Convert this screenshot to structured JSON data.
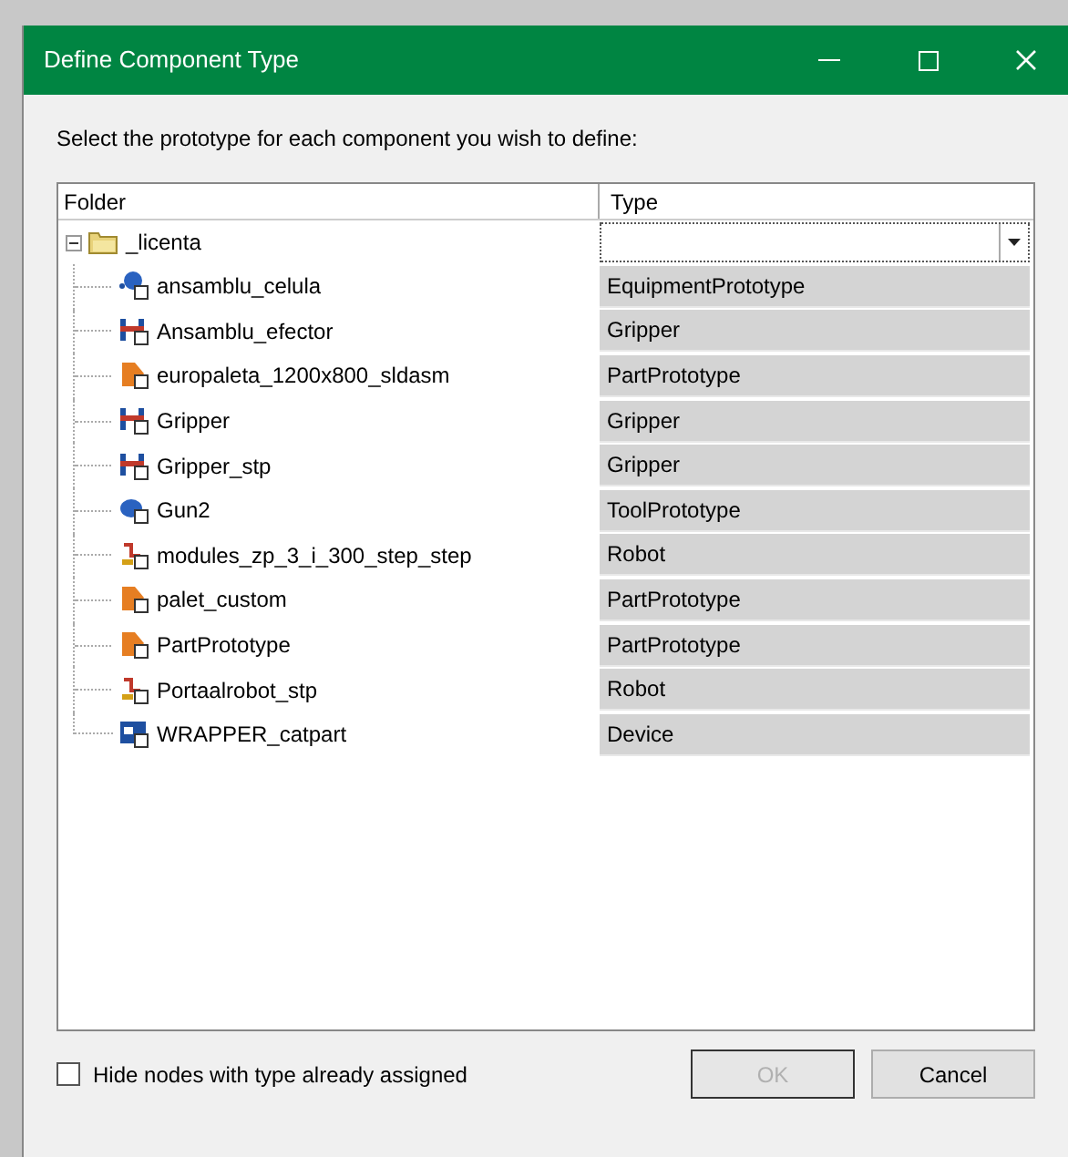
{
  "window": {
    "title": "Define Component Type"
  },
  "instruction": "Select the prototype for each component you wish to define:",
  "table": {
    "columns": [
      "Folder",
      "Type"
    ],
    "root": {
      "name": "_licenta",
      "expanded": true,
      "children": [
        {
          "name": "ansamblu_celula",
          "kind": "equipment",
          "type": "EquipmentPrototype"
        },
        {
          "name": "Ansamblu_efector",
          "kind": "gripper",
          "type": "Gripper"
        },
        {
          "name": "europaleta_1200x800_sldasm",
          "kind": "part",
          "type": "PartPrototype"
        },
        {
          "name": "Gripper",
          "kind": "gripper",
          "type": "Gripper"
        },
        {
          "name": "Gripper_stp",
          "kind": "gripper",
          "type": "Gripper"
        },
        {
          "name": "Gun2",
          "kind": "tool",
          "type": "ToolPrototype"
        },
        {
          "name": "modules_zp_3_i_300_step_step",
          "kind": "robot",
          "type": "Robot"
        },
        {
          "name": "palet_custom",
          "kind": "part",
          "type": "PartPrototype"
        },
        {
          "name": "PartPrototype",
          "kind": "part",
          "type": "PartPrototype"
        },
        {
          "name": "Portaalrobot_stp",
          "kind": "robot",
          "type": "Robot"
        },
        {
          "name": "WRAPPER_catpart",
          "kind": "device",
          "type": "Device"
        }
      ]
    }
  },
  "hide_assigned": {
    "label": "Hide nodes with type already assigned",
    "checked": false
  },
  "buttons": [
    {
      "label": "OK",
      "disabled": true
    },
    {
      "label": "Cancel",
      "disabled": false
    }
  ]
}
